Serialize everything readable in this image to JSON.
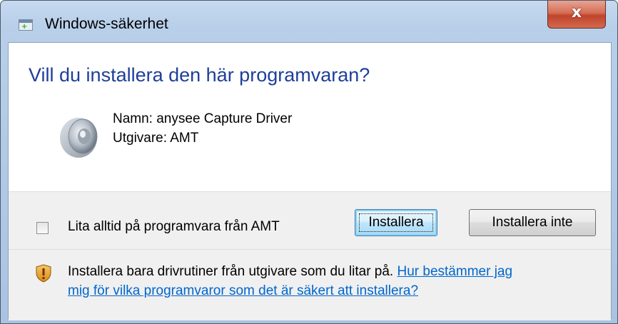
{
  "window": {
    "title": "Windows-säkerhet",
    "close_label": "x"
  },
  "main": {
    "heading": "Vill du installera den här programvaran?",
    "name_line": "Namn: anysee Capture Driver",
    "publisher_line": "Utgivare: AMT"
  },
  "footer": {
    "checkbox_label": "Lita alltid på programvara från AMT",
    "checkbox_checked": false,
    "install_label": "Installera",
    "dont_install_label": "Installera inte"
  },
  "warning": {
    "text": "Installera bara drivrutiner från utgivare som du litar på.",
    "link_part1": "Hur bestämmer jag",
    "link_part2": "mig för vilka programvaror som det är säkert att installera?"
  },
  "icons": {
    "title_icon": "window-app-icon",
    "device_icon": "speaker-icon",
    "warning_icon": "security-shield-icon"
  },
  "colors": {
    "heading": "#1e3f9a",
    "link": "#0066cc",
    "close_button": "#c0432a"
  }
}
